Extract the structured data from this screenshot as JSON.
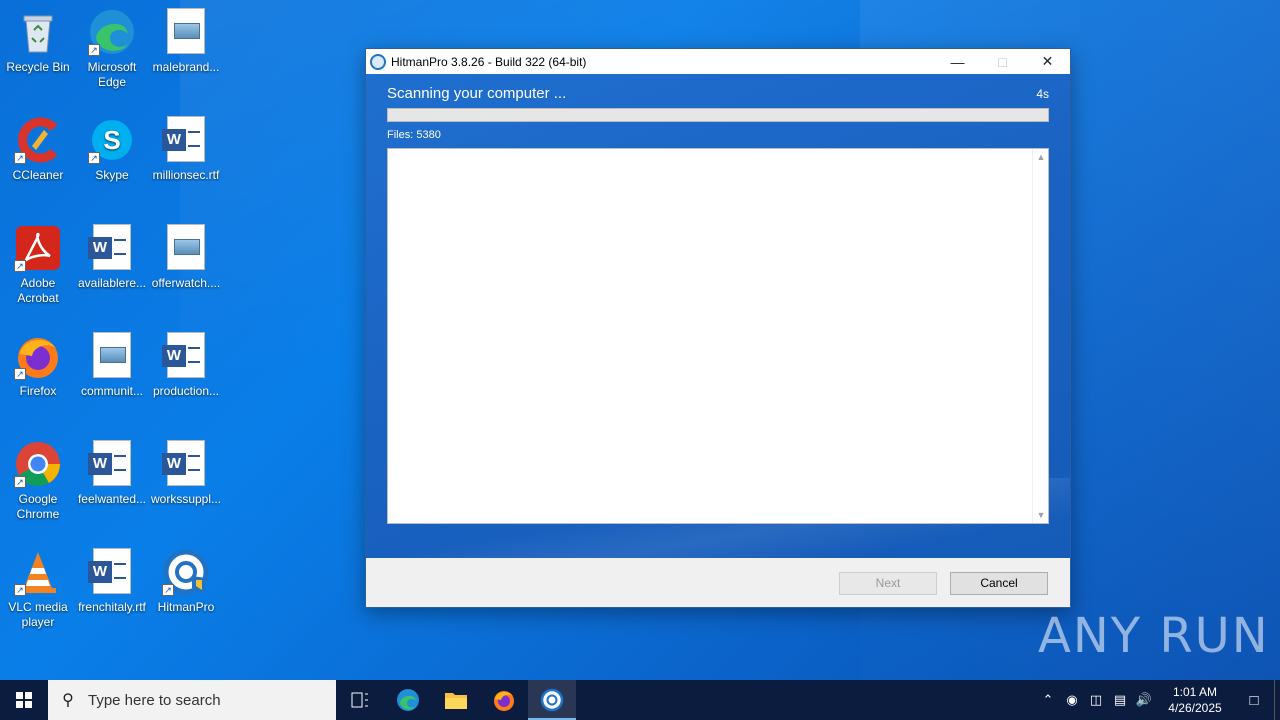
{
  "desktop": {
    "icons": [
      {
        "label": "Recycle Bin",
        "icon": "recycle-bin-icon"
      },
      {
        "label": "Microsoft Edge",
        "icon": "edge-icon"
      },
      {
        "label": "malebrand...",
        "icon": "image-file-icon"
      },
      {
        "label": "CCleaner",
        "icon": "ccleaner-icon"
      },
      {
        "label": "Skype",
        "icon": "skype-icon"
      },
      {
        "label": "millionsec.rtf",
        "icon": "word-doc-icon"
      },
      {
        "label": "Adobe Acrobat",
        "icon": "acrobat-icon"
      },
      {
        "label": "availablere...",
        "icon": "word-doc-icon"
      },
      {
        "label": "offerwatch....",
        "icon": "image-file-icon"
      },
      {
        "label": "Firefox",
        "icon": "firefox-icon"
      },
      {
        "label": "communit...",
        "icon": "image-file-icon"
      },
      {
        "label": "production...",
        "icon": "word-doc-icon"
      },
      {
        "label": "Google Chrome",
        "icon": "chrome-icon"
      },
      {
        "label": "feelwanted...",
        "icon": "word-doc-icon"
      },
      {
        "label": "workssuppl...",
        "icon": "word-doc-icon"
      },
      {
        "label": "VLC media player",
        "icon": "vlc-icon"
      },
      {
        "label": "frenchitaly.rtf",
        "icon": "word-doc-icon"
      },
      {
        "label": "HitmanPro",
        "icon": "hitmanpro-icon"
      }
    ]
  },
  "window": {
    "title": "HitmanPro 3.8.26 - Build 322 (64-bit)",
    "scan_title": "Scanning your computer ...",
    "elapsed": "4s",
    "progress_fraction": 0.0,
    "files_label": "Files:",
    "files_count": "5380",
    "next_label": "Next",
    "cancel_label": "Cancel"
  },
  "watermark": "ANY RUN",
  "taskbar": {
    "search_placeholder": "Type here to search",
    "time": "1:01 AM",
    "date": "4/26/2025"
  }
}
